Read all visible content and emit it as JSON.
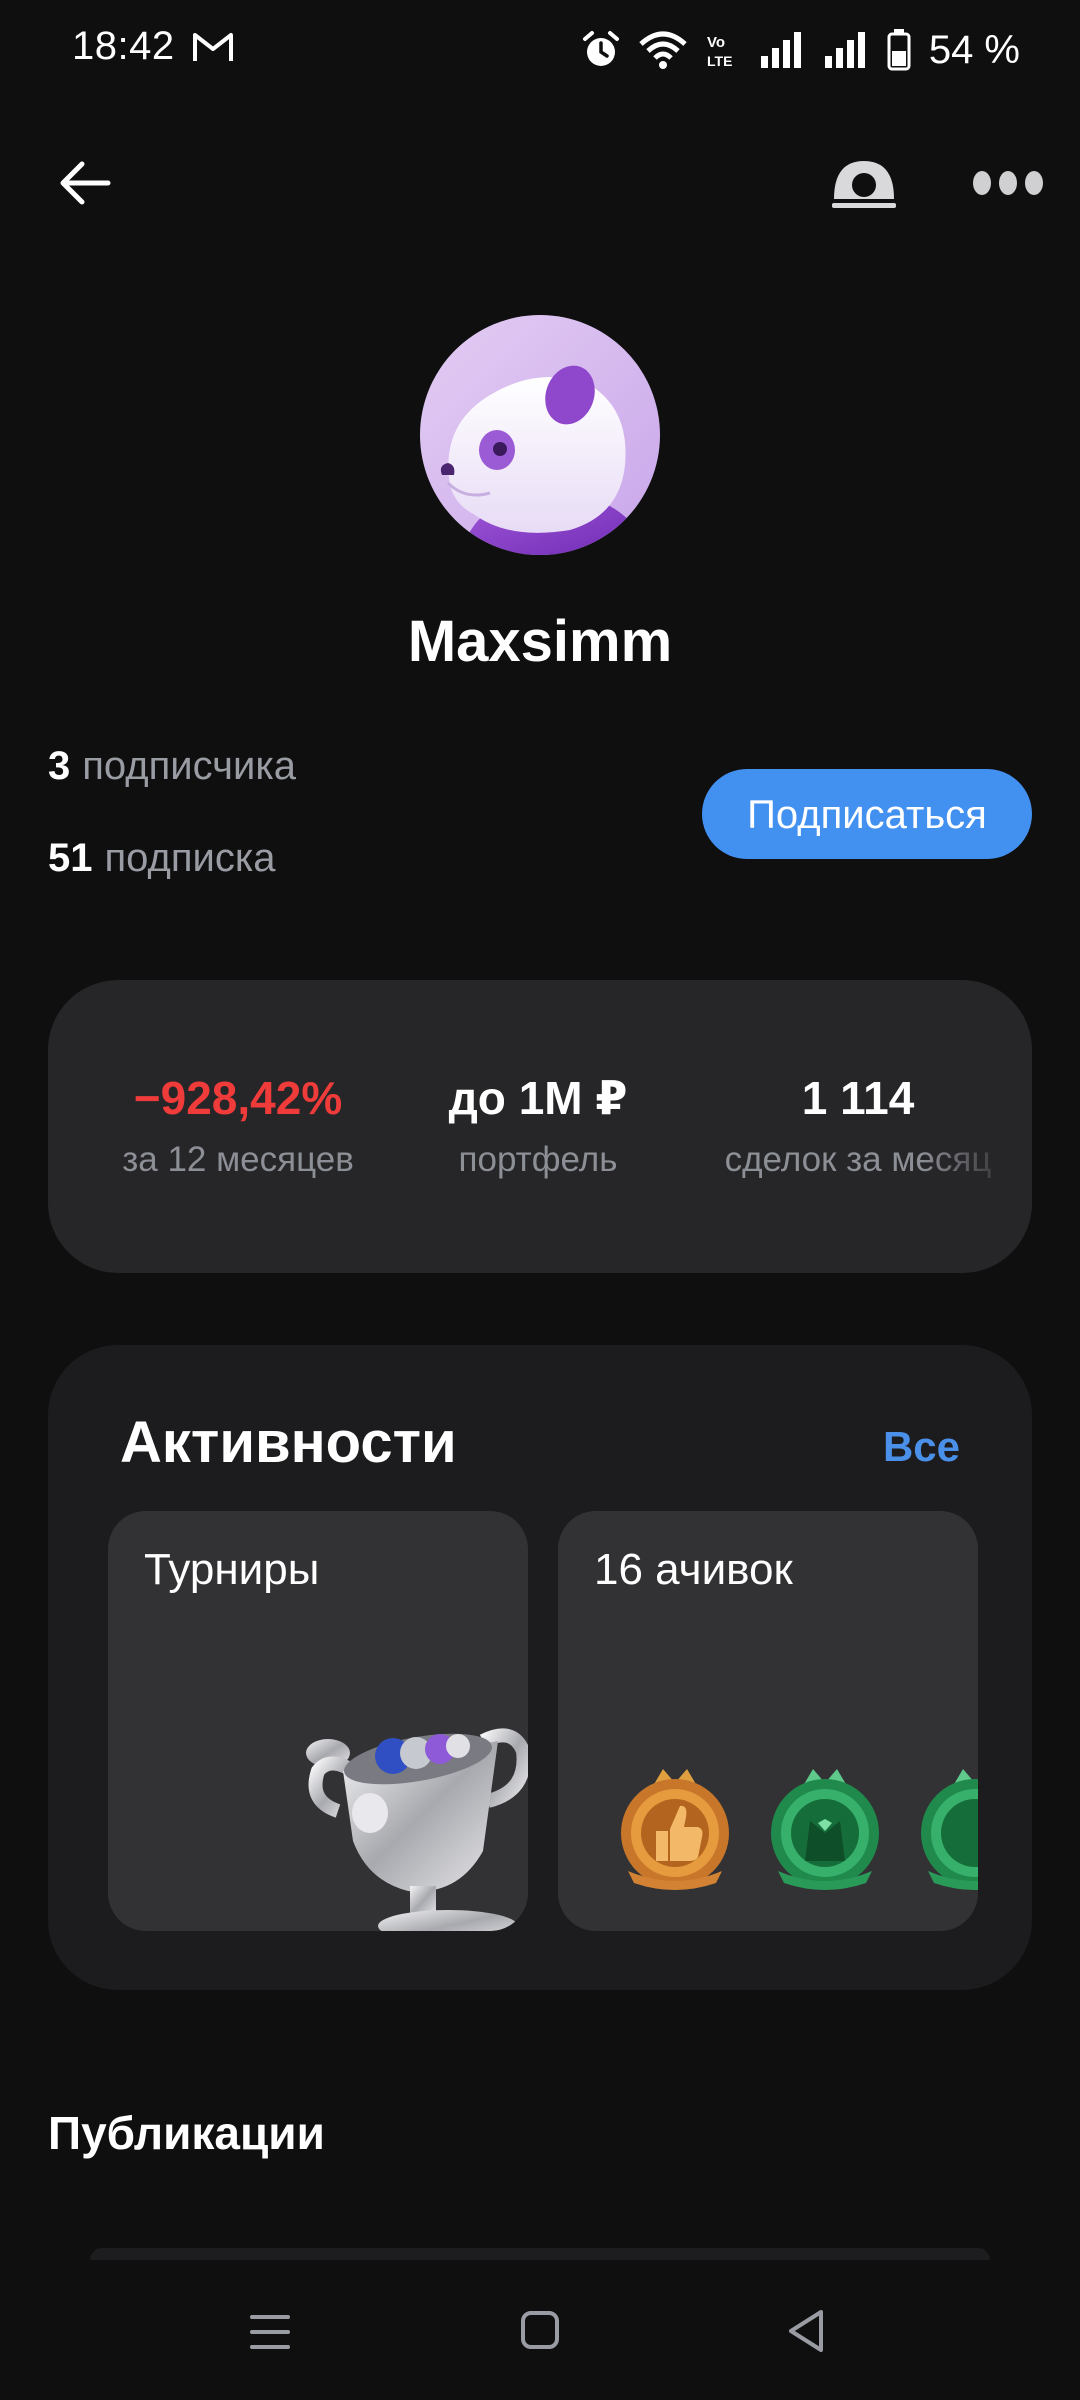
{
  "status_bar": {
    "time": "18:42",
    "battery": "54 %",
    "icons": [
      "gmail-icon",
      "alarm-icon",
      "wifi-icon",
      "volte-icon",
      "signal-icon",
      "signal-icon",
      "battery-icon"
    ]
  },
  "top_bar": {
    "icons": [
      "back-arrow-icon",
      "camera-icon",
      "more-dots-icon"
    ]
  },
  "profile": {
    "username": "Maxsimm",
    "followers_count": "3",
    "followers_label": "подписчика",
    "following_count": "51",
    "following_label": "подписка",
    "subscribe_label": "Подписаться",
    "avatar_icon": "panda-avatar-icon"
  },
  "stats": [
    {
      "value": "−928,42%",
      "label": "за 12 месяцев"
    },
    {
      "value": "до 1М ₽",
      "label": "портфель"
    },
    {
      "value": "1 114",
      "label": "сделок за месяц"
    }
  ],
  "activities": {
    "title": "Активности",
    "all_label": "Все",
    "tiles": [
      {
        "title": "Турниры",
        "icon": "trophy-icon"
      },
      {
        "title": "16 ачивок",
        "icons": [
          "like-badge-icon",
          "tuxedo-badge-icon",
          "green-badge-icon"
        ]
      }
    ]
  },
  "publications": {
    "title": "Публикации"
  },
  "nav_bar": {
    "icons": [
      "menu-icon",
      "home-icon",
      "back-icon"
    ]
  },
  "colors": {
    "background": "#0f0f10",
    "card": "#262628",
    "accent_blue": "#4290f0",
    "negative_red": "#f03b3b",
    "muted_text": "#8d8f96"
  }
}
